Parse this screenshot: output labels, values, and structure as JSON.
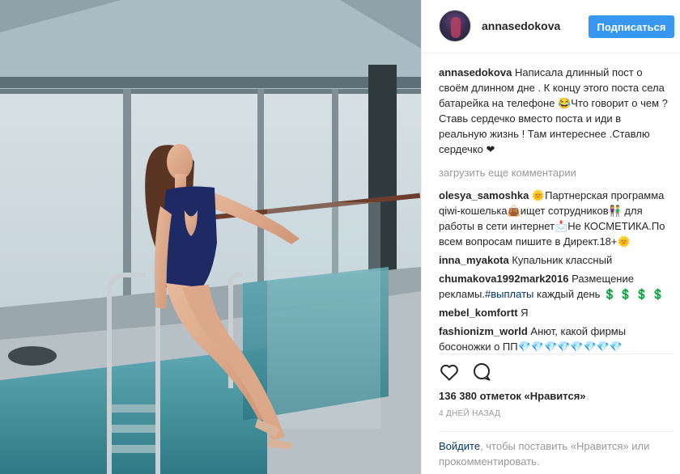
{
  "header": {
    "username": "annasedokova",
    "follow_label": "Подписаться"
  },
  "caption": {
    "user": "annasedokova",
    "text": "Написала длинный пост о своём длинном дне . К концу этого поста села батарейка на телефоне 😂Что говорит о чем ? Ставь сердечко вместо поста и иди в реальную жизнь ! Там интереснее .Ставлю сердечко ❤"
  },
  "load_more": "загрузить еще комментарии",
  "comments": [
    {
      "user": "olesya_samoshka",
      "text": "🌞Партнерская программа qiwi-кошелька👜ищет сотрудников👫 для работы в сети интернет📩Не КОСМЕТИКА.По всем вопросам пишите в Директ.18+🌞"
    },
    {
      "user": "inna_myakota",
      "text": "Купальник классный"
    },
    {
      "user": "chumakova1992mark2016",
      "text_before": "Размещение рекламы.",
      "hashtag": "#выплаты",
      "text_after": " каждый день",
      "money": "💲 💲 💲 💲"
    },
    {
      "user": "mebel_komfortt",
      "text": "Я"
    },
    {
      "user": "fashionizm_world",
      "text": "Анют, какой фирмы босоножки о ПП💎💎💎💎💎💎💎💎"
    }
  ],
  "actions": {
    "like_icon": "heart-outline-icon",
    "comment_icon": "speech-bubble-icon"
  },
  "likes": "136 380 отметок «Нравится»",
  "time": "4 дней назад",
  "login_prompt": {
    "link": "Войдите",
    "text": ", чтобы поставить «Нравится» или прокомментировать."
  },
  "colors": {
    "accent": "#3897f0",
    "text": "#262626",
    "muted": "#999999",
    "link": "#003569"
  }
}
